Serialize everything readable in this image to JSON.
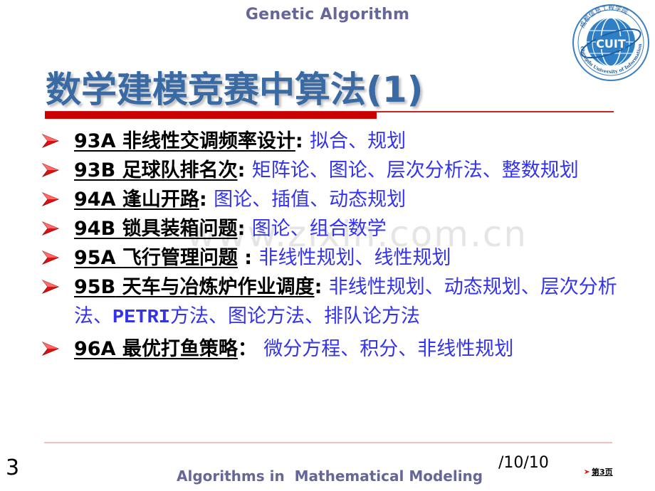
{
  "header": {
    "title": "Genetic Algorithm",
    "logo": {
      "icon": "cuit-logo-icon",
      "text": "CUIT",
      "ring_text_en": "Chengdu University of Information Technology",
      "ring_text_cn": "成都信息工程学院"
    }
  },
  "slide": {
    "title": "数学建模竞赛中算法(1)",
    "watermark": "www.zixin.com.cn",
    "items": [
      {
        "code": "93A",
        "problem": "非线性交调频率设计",
        "colon": ": ",
        "methods": "拟合、规划"
      },
      {
        "code": "93B",
        "problem": "足球队排名次",
        "colon": ": ",
        "methods": "矩阵论、图论、层次分析法、整数规划"
      },
      {
        "code": "94A",
        "problem": "逢山开路",
        "colon": ": ",
        "methods": "图论、插值、动态规划"
      },
      {
        "code": "94B",
        "problem": "锁具装箱问题",
        "colon": ": ",
        "methods": "图论、组合数学"
      },
      {
        "code": "95A",
        "problem": "飞行管理问题",
        "colon": " : ",
        "methods": "非线性规划、线性规划"
      },
      {
        "code": "95B",
        "problem": "天车与冶炼炉作业调度",
        "colon": ": ",
        "methods_before": "非线性规划、动态规划、层次分析法、",
        "methods_mono": "PETRI",
        "methods_after": "方法、图论方法、排队论方法"
      },
      {
        "code": "96A",
        "problem": "最优打鱼策略",
        "colon": "： ",
        "methods": "微分方程、积分、非线性规划"
      }
    ]
  },
  "footer": {
    "page_number": "3",
    "title": "Algorithms in  Mathematical Modeling",
    "date": "/10/10",
    "page_link": "第3页"
  },
  "colors": {
    "header_text": "#66669a",
    "title_text": "#3a6aa3",
    "accent_red": "#cc0000",
    "method_text": "#3333ee"
  }
}
